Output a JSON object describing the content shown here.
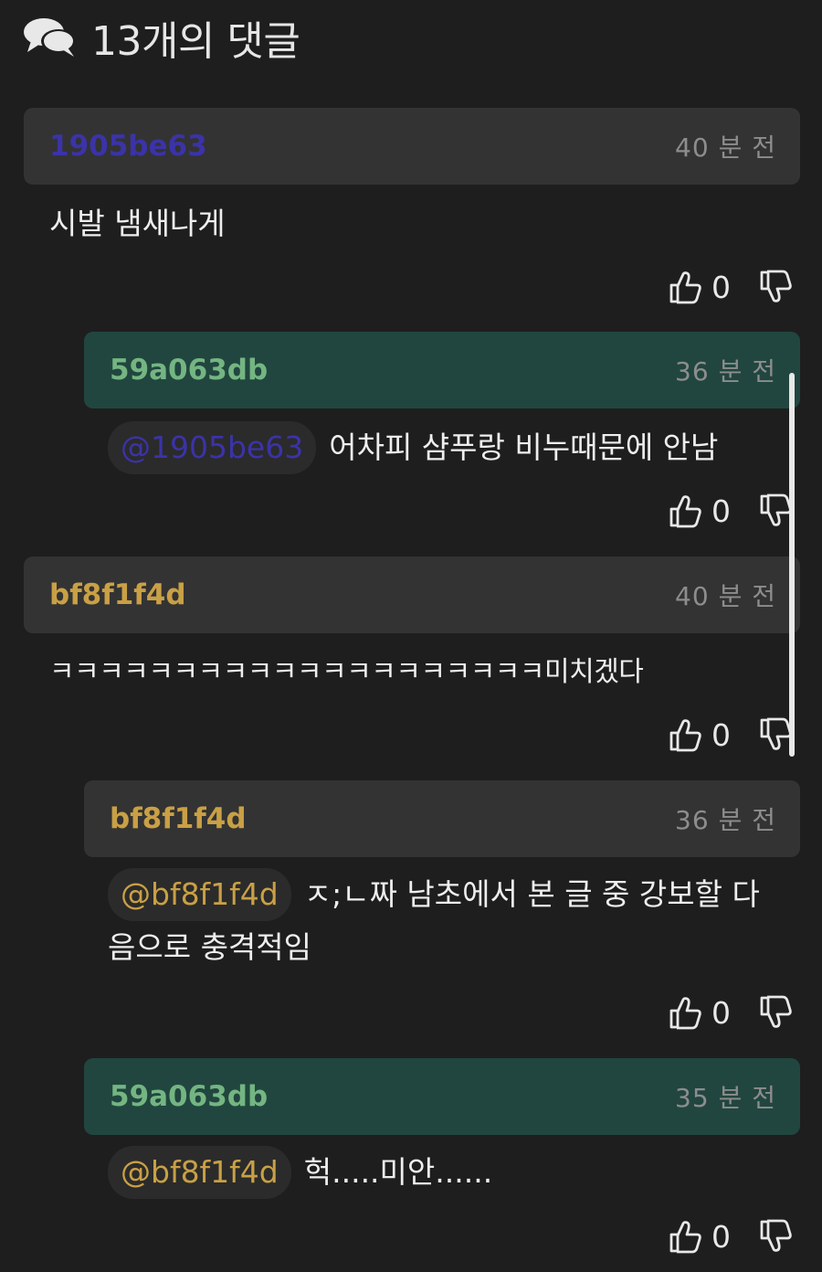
{
  "header": {
    "title": "13개의 댓글"
  },
  "colors": {
    "purple": "#3b33a8",
    "gold": "#c9a045",
    "green": "#74b582"
  },
  "comments": [
    {
      "author": "1905be63",
      "time": "40 분 전",
      "text": "시발 냄새나게",
      "up": "0"
    },
    {
      "author": "59a063db",
      "time": "36 분 전",
      "mention": "@1905be63",
      "text": "어차피 샴푸랑 비누때문에 안남",
      "up": "0"
    },
    {
      "author": "bf8f1f4d",
      "time": "40 분 전",
      "text": "ㅋㅋㅋㅋㅋㅋㅋㅋㅋㅋㅋㅋㅋㅋㅋㅋㅋㅋㅋㅋ미치겠다",
      "up": "0"
    },
    {
      "author": "bf8f1f4d",
      "time": "36 분 전",
      "mention": "@bf8f1f4d",
      "text": "ㅈ;ㄴ짜 남초에서 본 글 중 강보할 다",
      "text2": "음으로 충격적임",
      "up": "0"
    },
    {
      "author": "59a063db",
      "time": "35 분 전",
      "mention": "@bf8f1f4d",
      "text": "헉.....미안......",
      "up": "0"
    }
  ]
}
